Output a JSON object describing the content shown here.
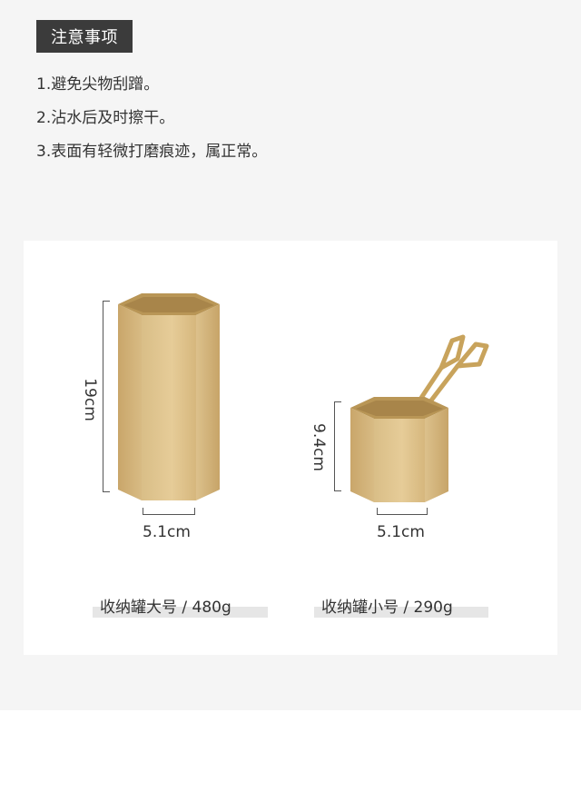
{
  "notice": {
    "title": "注意事项",
    "items": [
      "1.避免尖物刮蹭。",
      "2.沾水后及时擦干。",
      "3.表面有轻微打磨痕迹，属正常。"
    ]
  },
  "products": [
    {
      "height_label": "19cm",
      "width_label": "5.1cm",
      "caption": "收纳罐大号 / 480g"
    },
    {
      "height_label": "9.4cm",
      "width_label": "5.1cm",
      "caption": "收纳罐小号 / 290g"
    }
  ],
  "colors": {
    "page_bg": "#f5f5f5",
    "badge_bg": "#3b3b3b",
    "gold_light": "#e2c894",
    "gold_dark": "#c9a66a"
  }
}
